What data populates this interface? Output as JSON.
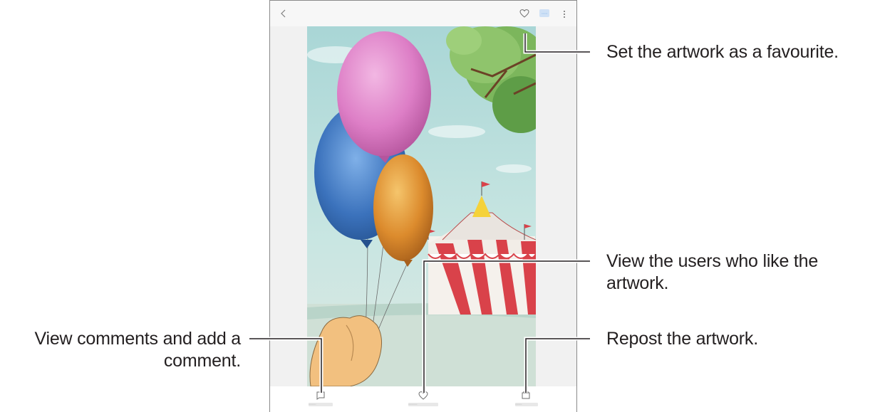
{
  "app": {
    "topbar": {
      "back_icon": "chevron-left-icon",
      "favourite_icon": "heart-icon",
      "more_icon": "more-vertical-icon",
      "label_hint": "••••••"
    },
    "bottombar": {
      "comments_icon": "comment-icon",
      "likes_icon": "heart-icon",
      "repost_icon": "repost-icon",
      "comments_label": "••••••••••",
      "likes_label": "••••••••••••",
      "repost_label": "•••••••••"
    },
    "colors": {
      "accent": "#7fb3e8",
      "sky": "#bfe0e0",
      "balloon_pink": "#e07cc0",
      "balloon_blue": "#3a6fb5",
      "balloon_orange": "#d9862a",
      "tent_red": "#d9424a",
      "tree_green": "#6aa84f"
    }
  },
  "callouts": {
    "favourite": "Set the artwork as a favourite.",
    "likes": "View the users who like the artwork.",
    "comments": "View comments and add a comment.",
    "repost": "Repost the artwork."
  }
}
